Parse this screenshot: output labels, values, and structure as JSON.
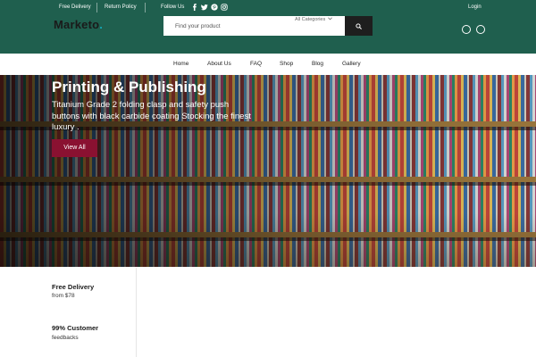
{
  "topbar": {
    "free_delivery": "Free Delivery",
    "return_policy": "Return Policy",
    "follow_us": "Follow Us",
    "login": "Login",
    "social_icons": [
      "facebook-icon",
      "twitter-icon",
      "pinterest-icon",
      "instagram-icon"
    ]
  },
  "logo": {
    "text": "Marketo",
    "dot": "."
  },
  "search": {
    "placeholder": "Find your product",
    "category": "All Categories"
  },
  "header_icons": [
    "cart-icon",
    "user-icon"
  ],
  "nav": {
    "items": [
      "Home",
      "About Us",
      "FAQ",
      "Shop",
      "Blog",
      "Gallery"
    ]
  },
  "hero": {
    "title": "Printing & Publishing",
    "subtitle": "Titanium Grade 2 folding clasp and safety push buttons with black carbide coating Stocking the finest luxury .",
    "button": "View All"
  },
  "features": [
    {
      "title": "Free Delivery",
      "subtitle": "from $78"
    },
    {
      "title": "99% Customer",
      "subtitle": "feedbacks"
    }
  ],
  "colors": {
    "header_bg": "#1f5f4e",
    "accent_button": "#8a1131",
    "search_button": "#1e1e1e",
    "logo_dot": "#13a8b8"
  }
}
